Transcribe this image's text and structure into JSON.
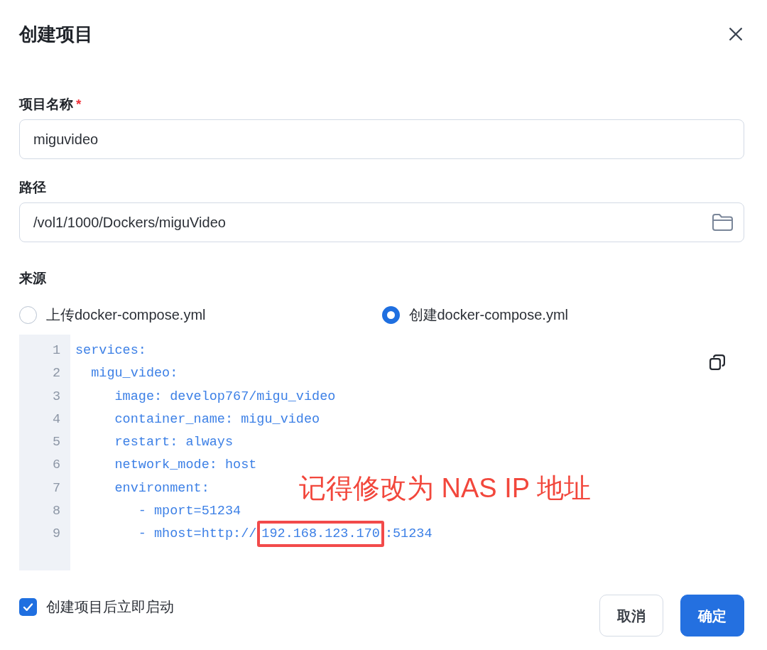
{
  "dialog": {
    "title": "创建项目"
  },
  "fields": [
    {
      "kind": "text",
      "label": "项目名称",
      "required_mark": "*",
      "value": "miguvideo"
    },
    {
      "kind": "path",
      "label": "路径",
      "value": "/vol1/1000/Dockers/miguVideo"
    }
  ],
  "source": {
    "label": "来源",
    "options": [
      {
        "label": "上传docker-compose.yml",
        "selected": false
      },
      {
        "label": "创建docker-compose.yml",
        "selected": true
      }
    ]
  },
  "editor": {
    "lines": [
      {
        "number": "1",
        "segments": [
          {
            "text": "services:",
            "boxed": false
          }
        ]
      },
      {
        "number": "2",
        "segments": [
          {
            "text": "  migu_video:",
            "boxed": false
          }
        ]
      },
      {
        "number": "3",
        "segments": [
          {
            "text": "     image: develop767/migu_video",
            "boxed": false
          }
        ]
      },
      {
        "number": "4",
        "segments": [
          {
            "text": "     container_name: migu_video",
            "boxed": false
          }
        ]
      },
      {
        "number": "5",
        "segments": [
          {
            "text": "     restart: always",
            "boxed": false
          }
        ]
      },
      {
        "number": "6",
        "segments": [
          {
            "text": "     network_mode: host",
            "boxed": false
          }
        ]
      },
      {
        "number": "7",
        "segments": [
          {
            "text": "     environment:",
            "boxed": false
          }
        ]
      },
      {
        "number": "8",
        "segments": [
          {
            "text": "        - mport=51234",
            "boxed": false
          }
        ]
      },
      {
        "number": "9",
        "segments": [
          {
            "text": "        - mhost=http://",
            "boxed": false
          },
          {
            "text": "192.168.123.170",
            "boxed": true
          },
          {
            "text": ":51234",
            "boxed": false
          }
        ]
      }
    ],
    "annotation": {
      "text": "记得修改为 NAS IP 地址"
    }
  },
  "start_after_create": {
    "label": "创建项目后立即启动",
    "checked": true
  },
  "buttons": [
    {
      "kind": "secondary",
      "label": "取消"
    },
    {
      "kind": "primary",
      "label": "确定"
    }
  ]
}
